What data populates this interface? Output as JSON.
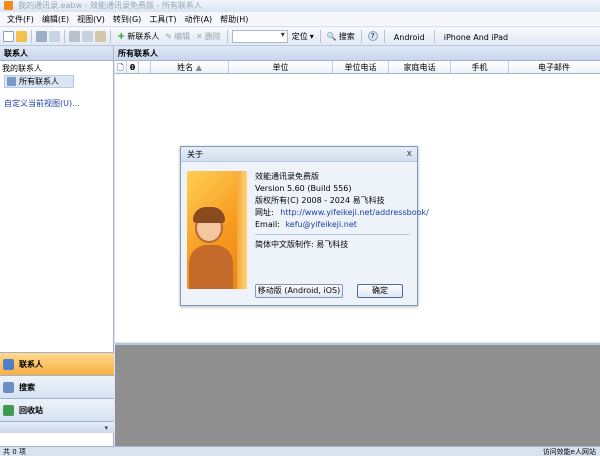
{
  "window": {
    "title": "我的通讯录.eabw - 效能通讯录免费版 - 所有联系人"
  },
  "menu": [
    "文件(F)",
    "编辑(E)",
    "视图(V)",
    "转到(G)",
    "工具(T)",
    "动作(A)",
    "帮助(H)"
  ],
  "toolbar": {
    "new_contact": "新联系人",
    "edit": "编辑",
    "delete": "删除",
    "locate": "定位",
    "search": "搜索",
    "android": "Android",
    "iphone_ipad": "iPhone And iPad"
  },
  "left_pane": {
    "header": "联系人",
    "root": "我的联系人",
    "item": "所有联系人",
    "custom_view": "自定义当前视图(U)..."
  },
  "nav": [
    {
      "label": "联系人",
      "active": true
    },
    {
      "label": "搜索",
      "active": false
    },
    {
      "label": "回收站",
      "active": false
    }
  ],
  "right_pane": {
    "header": "所有联系人",
    "columns": [
      "姓名",
      "单位",
      "单位电话",
      "家庭电话",
      "手机",
      "电子邮件"
    ]
  },
  "status": {
    "left": "共 0 项",
    "right": "访问效能e人网站"
  },
  "about": {
    "title": "关于",
    "close": "x",
    "product": "效能通讯录免费版",
    "version": "Version 5.60 (Build 556)",
    "copyright": "版权所有(C) 2008 - 2024 易飞科技",
    "website_label": "网址:",
    "website": "http://www.yifeikeji.net/addressbook/",
    "email_label": "Email:",
    "email": "kefu@yifeikeji.net",
    "localized_by": "简体中文版制作: 易飞科技",
    "mobile_button": "移动版 (Android, iOS)",
    "ok_button": "确定"
  },
  "colors": {
    "accent_orange": "#f7b042",
    "link_blue": "#1a3fa8",
    "panel_gray": "#8f8f8f"
  }
}
